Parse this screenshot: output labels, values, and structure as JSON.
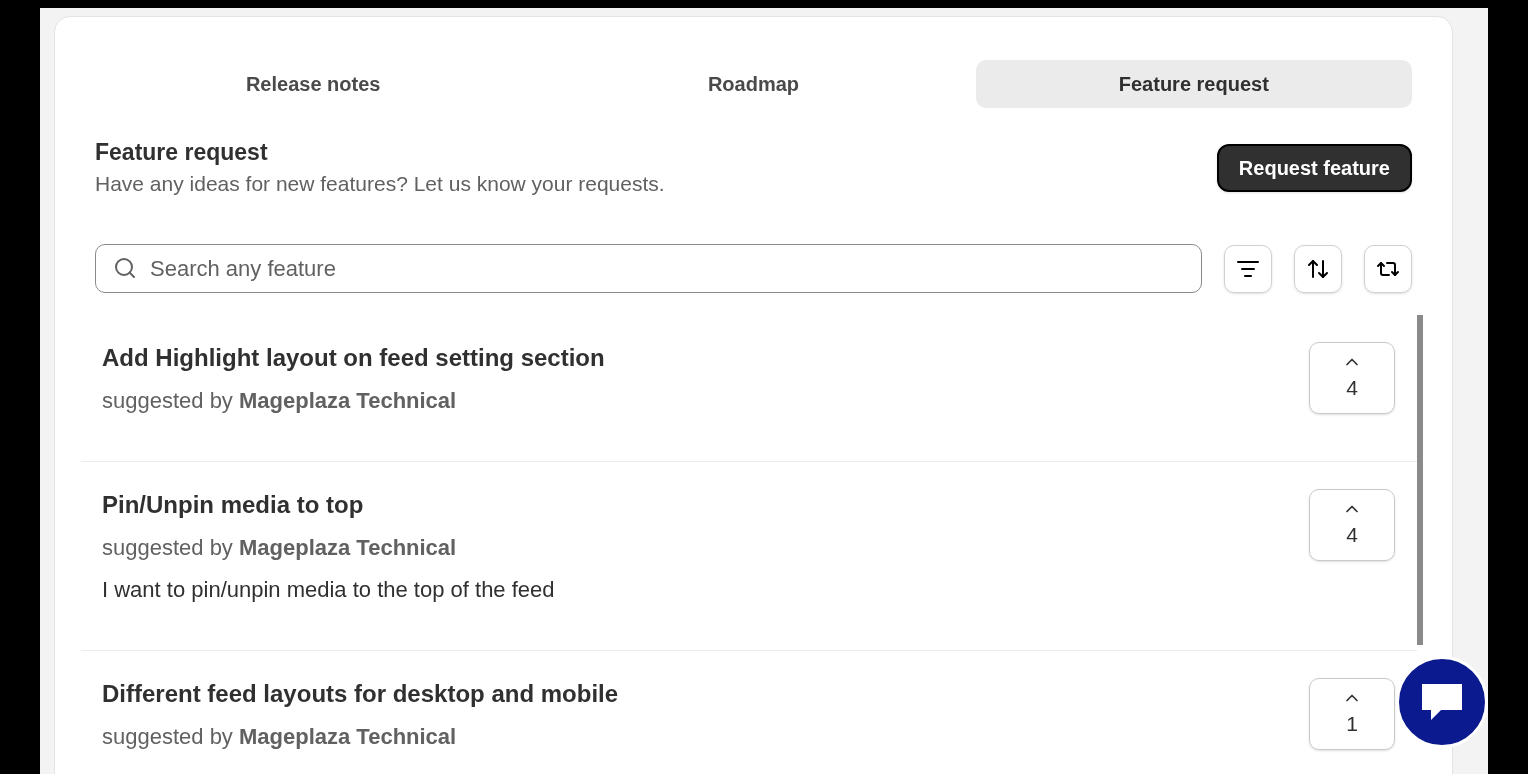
{
  "tabs": [
    {
      "label": "Release notes",
      "selected": false
    },
    {
      "label": "Roadmap",
      "selected": false
    },
    {
      "label": "Feature request",
      "selected": true
    }
  ],
  "header": {
    "title": "Feature request",
    "subtitle": "Have any ideas for new features? Let us know your requests.",
    "button": "Request feature"
  },
  "search": {
    "placeholder": "Search any feature"
  },
  "requests": [
    {
      "title": "Add Highlight layout on feed setting section",
      "author_line": "suggested by **Mageplaza Technical**",
      "votes": "4"
    },
    {
      "title": "Pin/Unpin media to top",
      "author_line": "suggested by **Mageplaza Technical**",
      "description": "I want to pin/unpin media to the top of the feed",
      "votes": "4"
    },
    {
      "title": "Different feed layouts for desktop and mobile",
      "author_line": "suggested by **Mageplaza Technical**",
      "votes": "1"
    }
  ]
}
